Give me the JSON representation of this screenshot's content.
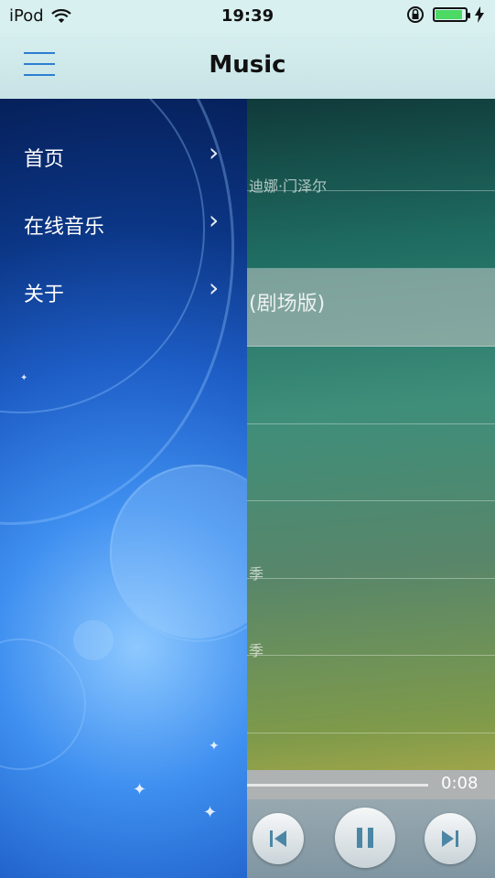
{
  "status": {
    "carrier": "iPod",
    "time": "19:39",
    "battery_level": 0.9
  },
  "nav": {
    "title": "Music"
  },
  "menu": {
    "items": [
      {
        "label": "首页"
      },
      {
        "label": "在线音乐"
      },
      {
        "label": "关于"
      }
    ]
  },
  "songs": [
    {
      "text": "迪娜·门泽尔"
    },
    {
      "text": ""
    },
    {
      "text": "(剧场版)"
    },
    {
      "text": ""
    },
    {
      "text": ""
    },
    {
      "text": "季"
    },
    {
      "text": "季"
    },
    {
      "text": ""
    }
  ],
  "player": {
    "elapsed": "0:08",
    "progress": 0.9
  },
  "colors": {
    "accent": "#2c7dd1",
    "battery": "#4cd964",
    "icon": "#4c86a5"
  }
}
